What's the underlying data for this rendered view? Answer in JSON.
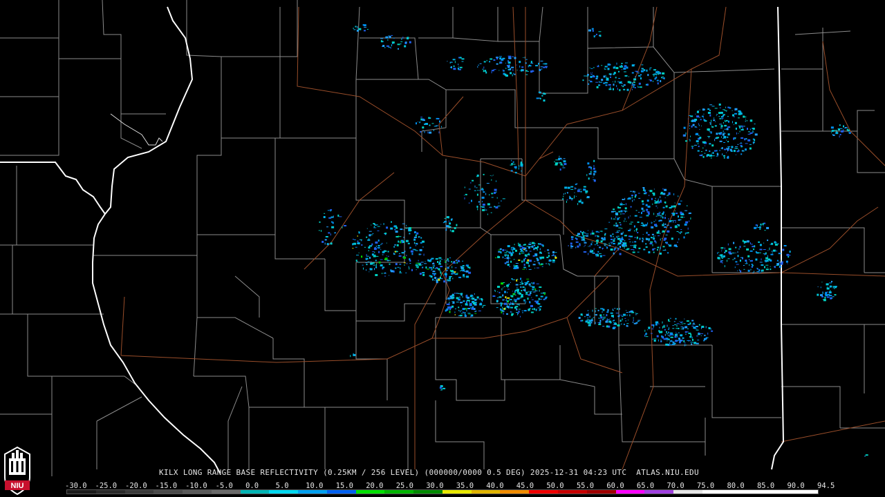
{
  "map": {
    "title": "KILX LONG RANGE BASE REFLECTIVITY (0.25KM / 256 LEVEL) (000000/0000 0.5 DEG) 2025-12-31 04:23 UTC  ATLAS.NIU.EDU",
    "colors": {
      "background": "#000000",
      "county_border": "#8c8c8c",
      "state_border": "#ffffff",
      "highway": "#9a4e2a"
    }
  },
  "legend": {
    "labels": [
      "-30.0",
      "-25.0",
      "-20.0",
      "-15.0",
      "-10.0",
      "-5.0",
      "0.0",
      "5.0",
      "10.0",
      "15.0",
      "20.0",
      "25.0",
      "30.0",
      "35.0",
      "40.0",
      "45.0",
      "50.0",
      "55.0",
      "60.0",
      "65.0",
      "70.0",
      "75.0",
      "80.0",
      "85.0",
      "90.0",
      "94.5"
    ],
    "colors": [
      "#1a1a1a",
      "#2a2a2a",
      "#3a3a3a",
      "#4a4a4a",
      "#5a5a5a",
      "#6a6a6a",
      "#00b4b4",
      "#00d8f0",
      "#00a0f0",
      "#0060f0",
      "#00e000",
      "#00b400",
      "#008a00",
      "#e8e800",
      "#e0b400",
      "#f08c00",
      "#f00000",
      "#c80000",
      "#a00000",
      "#ff00ff",
      "#a040e0",
      "#e6e6e6",
      "#ffffff",
      "#ffffff",
      "#ffffff",
      "#ffffff"
    ]
  },
  "logo": {
    "text": "NIU",
    "color": "#c8102e"
  }
}
